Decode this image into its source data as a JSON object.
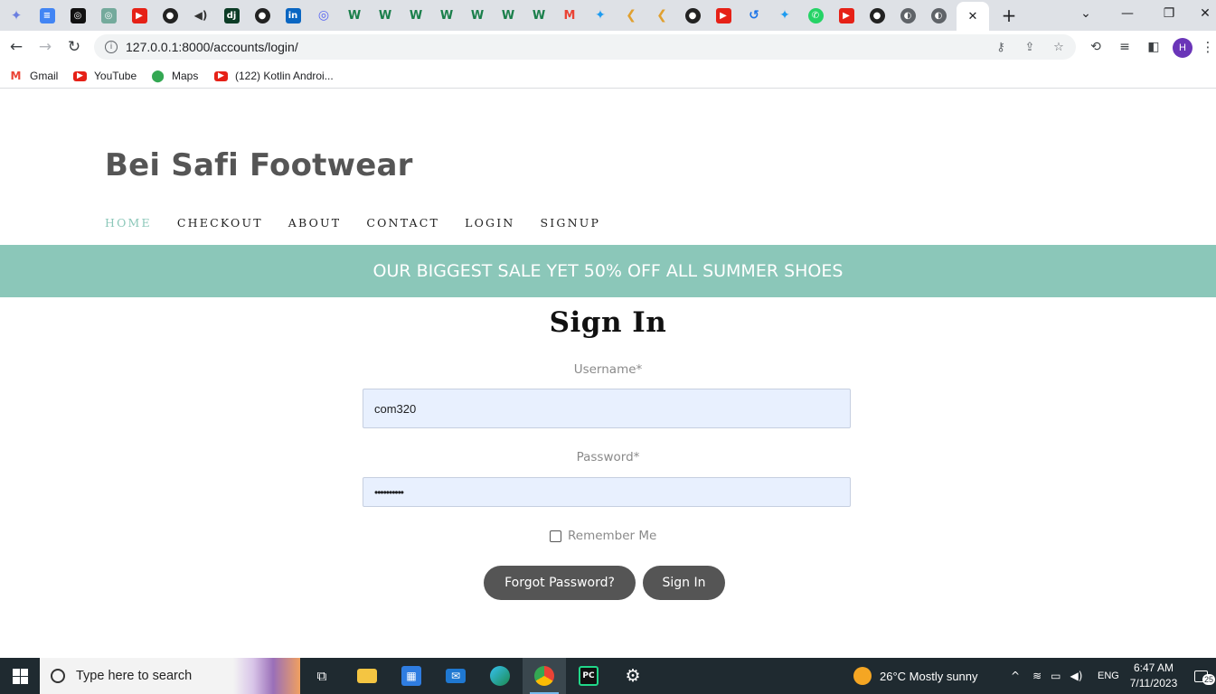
{
  "browser": {
    "url": "127.0.0.1:8000/accounts/login/",
    "active_tab_close": "✕",
    "new_tab": "+",
    "avatar_initial": "H",
    "bookmarks": [
      {
        "label": "Gmail",
        "icon": "gmail-icon"
      },
      {
        "label": "YouTube",
        "icon": "youtube-icon"
      },
      {
        "label": "Maps",
        "icon": "maps-icon"
      },
      {
        "label": "(122) Kotlin Androi...",
        "icon": "youtube-icon"
      }
    ]
  },
  "site": {
    "brand": "Bei Safi Footwear",
    "nav": [
      "HOME",
      "CHECKOUT",
      "ABOUT",
      "CONTACT",
      "LOGIN",
      "SIGNUP"
    ],
    "active_nav": "HOME",
    "promo": "OUR BIGGEST SALE YET 50% OFF ALL SUMMER SHOES",
    "accent_color": "#8bc7b9"
  },
  "login": {
    "title": "Sign In",
    "username_label": "Username*",
    "username_value": "com320",
    "password_label": "Password*",
    "password_value": "••••••••••",
    "remember_label": "Remember Me",
    "forgot_button": "Forgot Password?",
    "signin_button": "Sign In"
  },
  "taskbar": {
    "search_placeholder": "Type here to search",
    "weather": "26°C  Mostly sunny",
    "language": "ENG",
    "time": "6:47 AM",
    "date": "7/11/2023",
    "notifications": "25"
  }
}
